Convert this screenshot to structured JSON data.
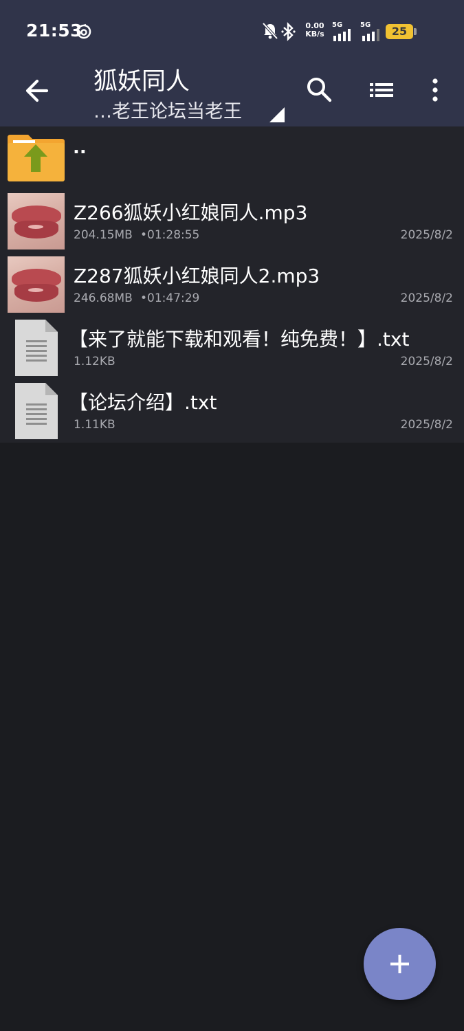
{
  "status_bar": {
    "time": "21:53",
    "net_speed_value": "0.00",
    "net_speed_unit": "KB/s",
    "sim1": "5G",
    "sim2": "5G",
    "battery": "25"
  },
  "app_bar": {
    "title": "狐妖同人",
    "subtitle": "…老王论坛当老王"
  },
  "files": [
    {
      "name": "..",
      "type": "parent-folder"
    },
    {
      "name": "Z266狐妖小红娘同人.mp3",
      "size": "204.15MB",
      "duration": "•01:28:55",
      "date": "2025/8/2",
      "type": "audio"
    },
    {
      "name": "Z287狐妖小红娘同人2.mp3",
      "size": "246.68MB",
      "duration": "•01:47:29",
      "date": "2025/8/2",
      "type": "audio"
    },
    {
      "name": "【来了就能下载和观看！纯免费！】.txt",
      "size": "1.12KB",
      "date": "2025/8/2",
      "type": "text"
    },
    {
      "name": "【论坛介绍】.txt",
      "size": "1.11KB",
      "date": "2025/8/2",
      "type": "text"
    }
  ],
  "colors": {
    "app_bar_bg": "#30344a",
    "list_bg": "#1b1c20",
    "row_bg": "#23242a",
    "fab_bg": "#7a85c8",
    "folder": "#f3a530",
    "folder_arrow": "#7a9a1c",
    "battery": "#f1c232"
  }
}
